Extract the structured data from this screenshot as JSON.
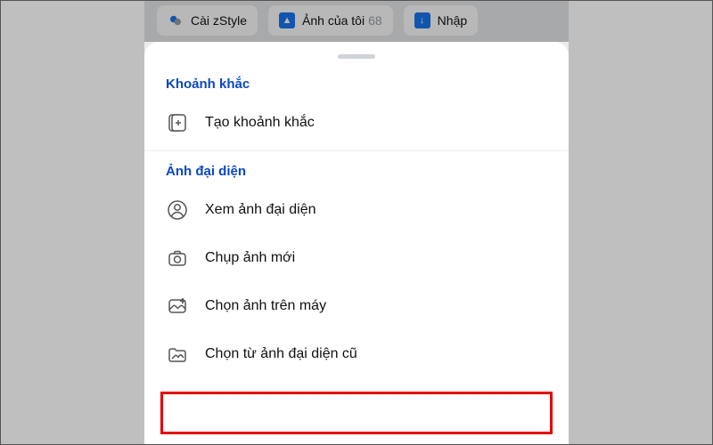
{
  "chips": {
    "zstyle": {
      "label": "Cài zStyle"
    },
    "myphotos": {
      "label": "Ảnh của tôi",
      "count": "68"
    },
    "import": {
      "label": "Nhập"
    }
  },
  "sections": {
    "moments": {
      "title": "Khoảnh khắc",
      "create": "Tạo khoảnh khắc"
    },
    "avatar": {
      "title": "Ảnh đại diện",
      "view": "Xem ảnh đại diện",
      "take": "Chụp ảnh mới",
      "choose_device": "Chọn ảnh trên máy",
      "choose_old": "Chọn từ ảnh đại diện cũ"
    }
  }
}
